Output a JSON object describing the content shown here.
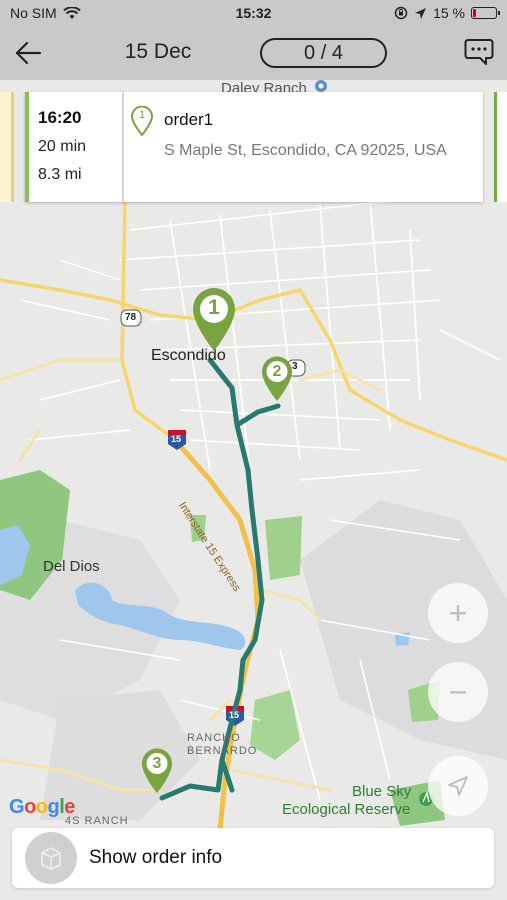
{
  "status_bar": {
    "carrier": "No SIM",
    "time": "15:32",
    "battery": "15 %",
    "battery_level": 0.15
  },
  "nav": {
    "date": "15 Dec",
    "progress": "0 / 4"
  },
  "order_card": {
    "time": "16:20",
    "duration": "20 min",
    "distance": "8.3 mi",
    "pin_number": "1",
    "name": "order1",
    "address": "S Maple St, Escondido, CA 92025, USA"
  },
  "map": {
    "labels": {
      "daley_ranch": "Daley Ranch",
      "escondido": "Escondido",
      "del_dios": "Del Dios",
      "interstate": "Interstate 15 Express",
      "rancho_bernardo_1": "RANCHO",
      "rancho_bernardo_2": "BERNARDO",
      "blue_sky_1": "Blue Sky",
      "blue_sky_2": "Ecological Reserve",
      "four_s_ranch": "4S RANCH",
      "route_78": "78",
      "route_15_a": "15",
      "route_15_b": "15",
      "route_3": "3"
    },
    "markers": [
      "1",
      "2",
      "3"
    ],
    "route_color": "#287a6f",
    "marker_color": "#79a340",
    "google": "Google"
  },
  "controls": {
    "zoom_in": "+",
    "zoom_out": "−"
  },
  "bottom": {
    "label": "Show order info"
  }
}
